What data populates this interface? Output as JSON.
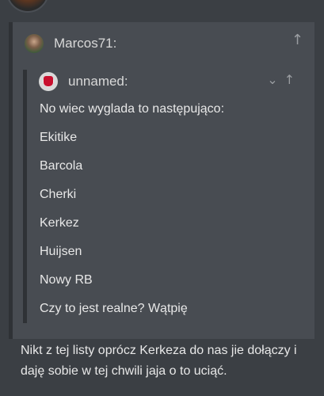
{
  "outer_quote": {
    "username": "Marcos71:",
    "arrow_icon": "arrow-up-icon"
  },
  "inner_quote": {
    "username": "unnamed:",
    "expand_icon": "chevron-down-icon",
    "arrow_icon": "arrow-up-icon",
    "lines": [
      "No wiec wyglada to następująco:",
      "Ekitike",
      "Barcola",
      "Cherki",
      "Kerkez",
      "Huijsen",
      "Nowy RB",
      "Czy to jest realne? Wątpię"
    ]
  },
  "reply": {
    "text": "Nikt z tej listy oprócz Kerkeza do nas jie dołączy i daję sobie w tej chwili jaja o to uciąć."
  }
}
